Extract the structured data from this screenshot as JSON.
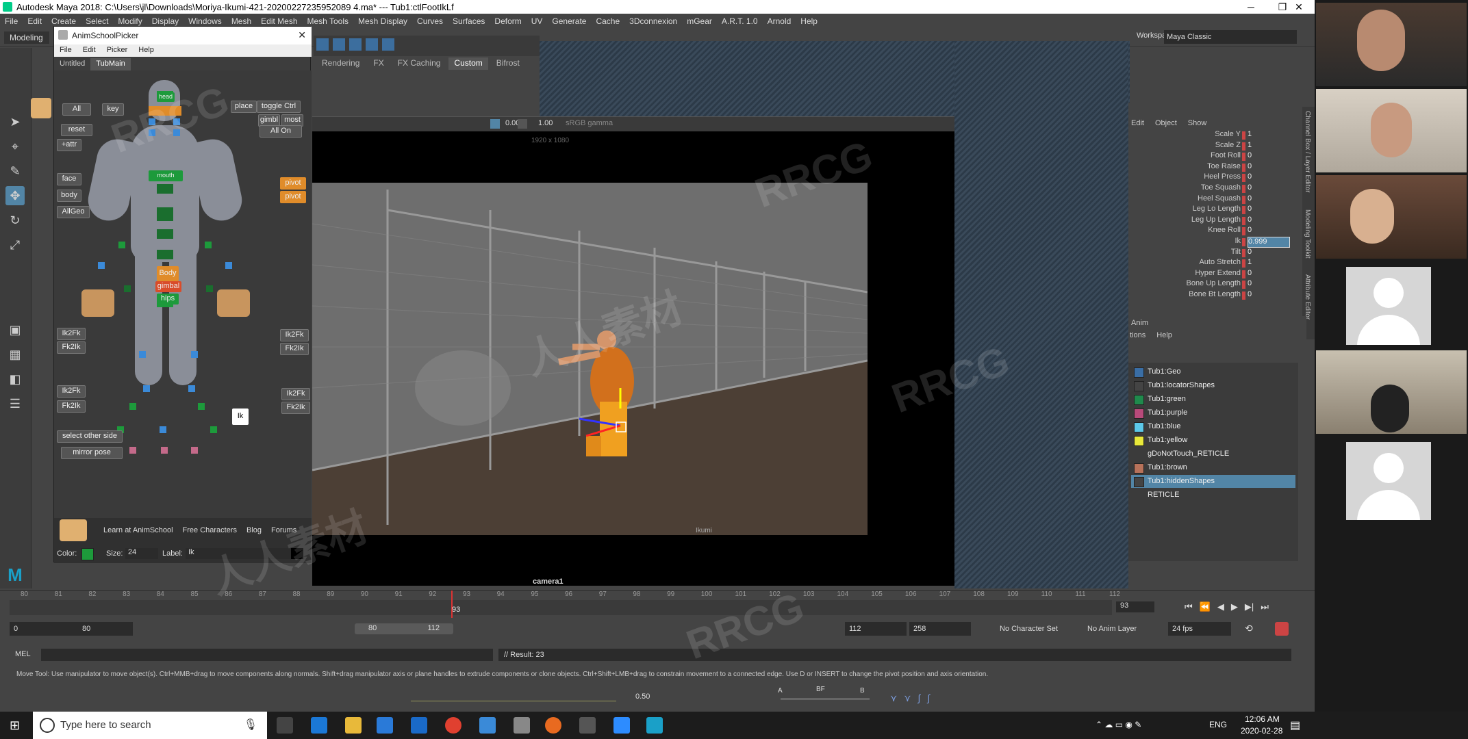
{
  "window": {
    "title": "Autodesk Maya 2018: C:\\Users\\jl\\Downloads\\Moriya-Ikumi-421-20200227235952089 4.ma*   ---   Tub1:ctlFootIkLf",
    "minimize": "─",
    "maximize": "❐",
    "close": "✕"
  },
  "menubar": [
    "File",
    "Edit",
    "Create",
    "Select",
    "Modify",
    "Display",
    "Windows",
    "Mesh",
    "Edit Mesh",
    "Mesh Tools",
    "Mesh Display",
    "Curves",
    "Surfaces",
    "Deform",
    "UV",
    "Generate",
    "Cache",
    "3Dconnexion",
    "mGear",
    "A.R.T. 1.0",
    "Arnold",
    "Help"
  ],
  "workspace": {
    "label": "Workspace :",
    "value": "Maya Classic"
  },
  "modeling_menu": "Modeling",
  "shelf_tabs": [
    "Rendering",
    "FX",
    "FX Caching",
    "Custom",
    "Bifrost"
  ],
  "shelf_active": "Custom",
  "viewport": {
    "exposure": "0.00",
    "gamma": "1.00",
    "colorspace": "sRGB gamma",
    "resolution": "1920 x 1080",
    "camera_label": "camera1",
    "scene_caption": "Ikumi"
  },
  "picker": {
    "title": "AnimSchoolPicker",
    "menu": [
      "File",
      "Edit",
      "Picker",
      "Help"
    ],
    "tabs": [
      "Untitled",
      "TubMain"
    ],
    "active_tab": "TubMain",
    "buttons": {
      "all": "All",
      "key": "key",
      "reset": "reset",
      "attr": "+attr",
      "place": "place",
      "toggle": "toggle Ctrl",
      "gimbl": "gimbl",
      "most": "most",
      "allon": "All On",
      "face": "face",
      "body": "body",
      "allgeo": "AllGeo",
      "pivot1": "pivot",
      "pivot2": "pivot",
      "head": "head",
      "mouth": "mouth",
      "body_ctrl": "Body",
      "gimbal": "gimbal",
      "hips": "hips",
      "ik2fk1": "Ik2Fk",
      "fk2ik1": "Fk2Ik",
      "ik2fk2": "Ik2Fk",
      "fk2ik2": "Fk2Ik",
      "ik2fk3": "Ik2Fk",
      "fk2ik3": "Fk2Ik",
      "ik2fk4": "Ik2Fk",
      "fk2ik4": "Fk2Ik",
      "ik_sel": "Ik",
      "select_other": "select other side",
      "mirror": "mirror pose"
    },
    "footer_links": [
      "Learn at AnimSchool",
      "Free Characters",
      "Blog",
      "Forums"
    ],
    "color_label": "Color:",
    "size_label": "Size:",
    "size_value": "24",
    "label_label": "Label:",
    "label_value": "Ik"
  },
  "channel_box": {
    "menu": [
      "Edit",
      "Object",
      "Show"
    ],
    "attributes": [
      {
        "name": "Scale Y",
        "value": "1"
      },
      {
        "name": "Scale Z",
        "value": "1"
      },
      {
        "name": "Foot Roll",
        "value": "0"
      },
      {
        "name": "Toe Raise",
        "value": "0"
      },
      {
        "name": "Heel Press",
        "value": "0"
      },
      {
        "name": "Toe Squash",
        "value": "0"
      },
      {
        "name": "Heel Squash",
        "value": "0"
      },
      {
        "name": "Leg Lo Length",
        "value": "0"
      },
      {
        "name": "Leg Up Length",
        "value": "0"
      },
      {
        "name": "Knee Roll",
        "value": "0"
      },
      {
        "name": "Ik",
        "value": "0.999"
      },
      {
        "name": "Tilt",
        "value": "0"
      },
      {
        "name": "Auto Stretch",
        "value": "1"
      },
      {
        "name": "Hyper Extend",
        "value": "0"
      },
      {
        "name": "Bone Up Length",
        "value": "0"
      },
      {
        "name": "Bone Bt Length",
        "value": "0"
      }
    ],
    "side_tabs": [
      "Channel Box / Layer Editor",
      "Modeling Toolkit",
      "Attribute Editor"
    ]
  },
  "layer_editor": {
    "tab": "Anim",
    "menu": [
      "tions",
      "Help"
    ],
    "layers": [
      {
        "name": "Tub1:Geo",
        "color": "#3a6ea5"
      },
      {
        "name": "Tub1:locatorShapes",
        "color": "#444444"
      },
      {
        "name": "Tub1:green",
        "color": "#1f8a4c"
      },
      {
        "name": "Tub1:purple",
        "color": "#b84a7a"
      },
      {
        "name": "Tub1:blue",
        "color": "#5cc8e8"
      },
      {
        "name": "Tub1:yellow",
        "color": "#e8e83a"
      },
      {
        "name": "gDoNotTouch_RETICLE",
        "color": ""
      },
      {
        "name": "Tub1:brown",
        "color": "#b8725a"
      },
      {
        "name": "Tub1:hiddenShapes",
        "color": "#444444"
      },
      {
        "name": "RETICLE",
        "color": ""
      }
    ],
    "selected": "Tub1:hiddenShapes"
  },
  "timeline": {
    "ticks": [
      "80",
      "81",
      "82",
      "83",
      "84",
      "85",
      "86",
      "87",
      "88",
      "89",
      "90",
      "91",
      "92",
      "93",
      "94",
      "95",
      "96",
      "97",
      "98",
      "99",
      "100",
      "101",
      "102",
      "103",
      "104",
      "105",
      "106",
      "107",
      "108",
      "109",
      "110",
      "111",
      "112"
    ],
    "current_frame": "93",
    "current_frame_field": "93"
  },
  "range": {
    "start": "0",
    "range_start": "80",
    "slider_start": "80",
    "slider_end": "112",
    "range_end": "112",
    "end": "258",
    "character_set": "No Character Set",
    "anim_layer": "No Anim Layer",
    "fps": "24 fps"
  },
  "command_line": {
    "label": "MEL",
    "result": "// Result: 23"
  },
  "help_line": "Move Tool: Use manipulator to move object(s). Ctrl+MMB+drag to move components along normals. Shift+drag manipulator axis or plane handles to extrude components or clone objects. Ctrl+Shift+LMB+drag to constrain movement to a connected edge. Use D or INSERT to change the pivot position and axis orientation.",
  "status": {
    "blend_value": "0.50",
    "a_label": "A",
    "bf_label": "BF",
    "b_label": "B"
  },
  "taskbar": {
    "search_placeholder": "Type here to search",
    "time": "12:06 AM",
    "date": "2020-02-28",
    "lang": "ENG"
  },
  "watermark": {
    "latin": "RRCG",
    "cjk": "人人素材"
  },
  "video_call": {
    "participants": 6
  }
}
